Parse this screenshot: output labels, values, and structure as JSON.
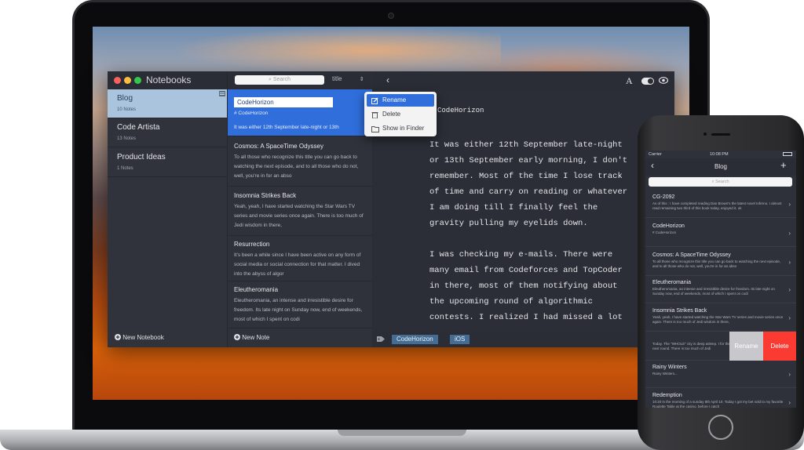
{
  "app": {
    "title": "Notebooks"
  },
  "notebooks": [
    {
      "name": "Blog",
      "count": "10 Notes",
      "selected": true
    },
    {
      "name": "Code Artista",
      "count": "13 Notes"
    },
    {
      "name": "Product Ideas",
      "count": "1 Notes"
    }
  ],
  "new_notebook_label": "New Notebook",
  "notes_panel": {
    "search_placeholder": "Search",
    "sort_value": "title",
    "new_note_label": "New Note"
  },
  "notes": [
    {
      "title": "CodeHorizon",
      "tag_line": "# CodeHorizon",
      "preview": "It was either 12th September late-night or 13th",
      "selected": true
    },
    {
      "title": "Cosmos: A SpaceTime Odyssey",
      "preview": "To all those who recognize this title you can go back to watching the next episode, and to all those who do not, well, you're in for an abso"
    },
    {
      "title": "Insomnia Strikes Back",
      "preview": "Yeah, yeah, I have started watching the Star Wars TV series and movie series once again. There is too much of Jedi wisdom in there,"
    },
    {
      "title": "Resurrection",
      "preview": "It's been a while since I have been active on any form of social media or social connection for that matter. I dived into the abyss of algor"
    },
    {
      "title": "Eleutheromania",
      "preview": "Eleutheromania, an intense and irresistible desire for freedom. Its late night on Sunday now, end of weekends, most of which I spent on codi"
    }
  ],
  "context_menu": [
    {
      "label": "Rename",
      "icon": "edit-icon",
      "highlighted": true
    },
    {
      "label": "Delete",
      "icon": "trash-icon"
    },
    {
      "label": "Show in Finder",
      "icon": "folder-icon"
    }
  ],
  "editor": {
    "heading": "CodeHorizon",
    "lines": [
      "It was either 12th September late-night",
      "or 13th September early morning, I don't",
      "remember. Most of the time I lose track",
      "of time and carry on reading or whatever",
      "I am doing till I finally feel the",
      "gravity pulling my eyelids down.",
      "",
      "I was checking my e-mails. There were",
      "many email from Codeforces and TopCoder",
      "in there, most of them notifying about",
      "the upcoming round of algorithmic",
      "contests. I realized I had missed a lot"
    ],
    "tags": [
      "CodeHorizon",
      "iOS"
    ]
  },
  "phone": {
    "carrier": "Carrier",
    "time": "10:08 PM",
    "title": "Blog",
    "search_placeholder": "Search",
    "swipe_rename": "Rename",
    "swipe_delete": "Delete",
    "notes": [
      {
        "title": "CG-2092",
        "preview": "As of this : I have completed reading Dan Brown's the latest novel Inferno. I almost read remaining two third of this book today, enjoyed it. ok"
      },
      {
        "title": "CodeHorizon",
        "preview": "# CodeHorizon"
      },
      {
        "title": "Cosmos: A SpaceTime Odyssey",
        "preview": "To all those who recognize this title you can go back to watching the next episode, and to all those who do not, well, you're in for an abso"
      },
      {
        "title": "Eleutheromania",
        "preview": "Eleutheromania, an intense and irresistible desire for freedom. Its late night on Sunday now, end of weekends, most of which I spent on codi"
      },
      {
        "title": "Insomnia Strikes Back",
        "preview": "Yeah, yeah, I have started watching the Star Wars TV series and movie series once again. There is too much of Jedi wisdom in there,"
      },
      {
        "title": "",
        "preview": "Today. The \"WHOLE\" city is deep asleep. I for the next round. There is too much of Jedi"
      },
      {
        "title": "Rainy Winters",
        "preview": "Rainy Winters..."
      },
      {
        "title": "Redemption",
        "preview": "10:20 in the morning of a sunday 8th April 10. Today I got my bet sold to my favorite Roulette Table at the casino, before I catch"
      }
    ]
  }
}
